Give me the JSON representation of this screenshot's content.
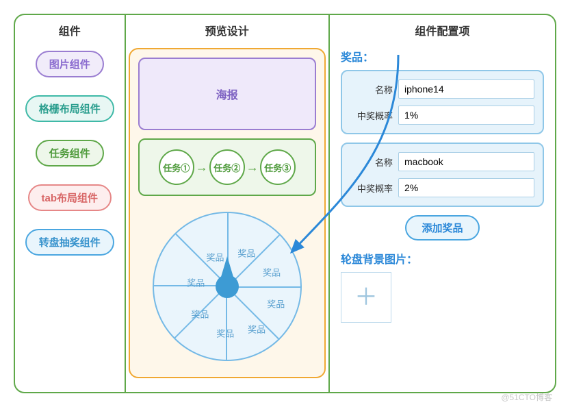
{
  "columns": {
    "left_title": "组件",
    "mid_title": "预览设计",
    "right_title": "组件配置项"
  },
  "components": [
    {
      "label": "图片组件",
      "style": "purple"
    },
    {
      "label": "格栅布局组件",
      "style": "teal"
    },
    {
      "label": "任务组件",
      "style": "green"
    },
    {
      "label": "tab布局组件",
      "style": "red"
    },
    {
      "label": "转盘抽奖组件",
      "style": "blue"
    }
  ],
  "preview": {
    "poster_label": "海报",
    "tasks": [
      "任务①",
      "任务②",
      "任务③"
    ],
    "wheel_slice_label": "奖品",
    "wheel_slices": 8
  },
  "config": {
    "section_label": "奖品：",
    "name_label": "名称",
    "prob_label": "中奖概率",
    "prizes": [
      {
        "name": "iphone14",
        "prob": "1%"
      },
      {
        "name": "macbook",
        "prob": "2%"
      }
    ],
    "add_button": "添加奖品",
    "bg_label": "轮盘背景图片："
  },
  "watermark": "@51CTO博客"
}
